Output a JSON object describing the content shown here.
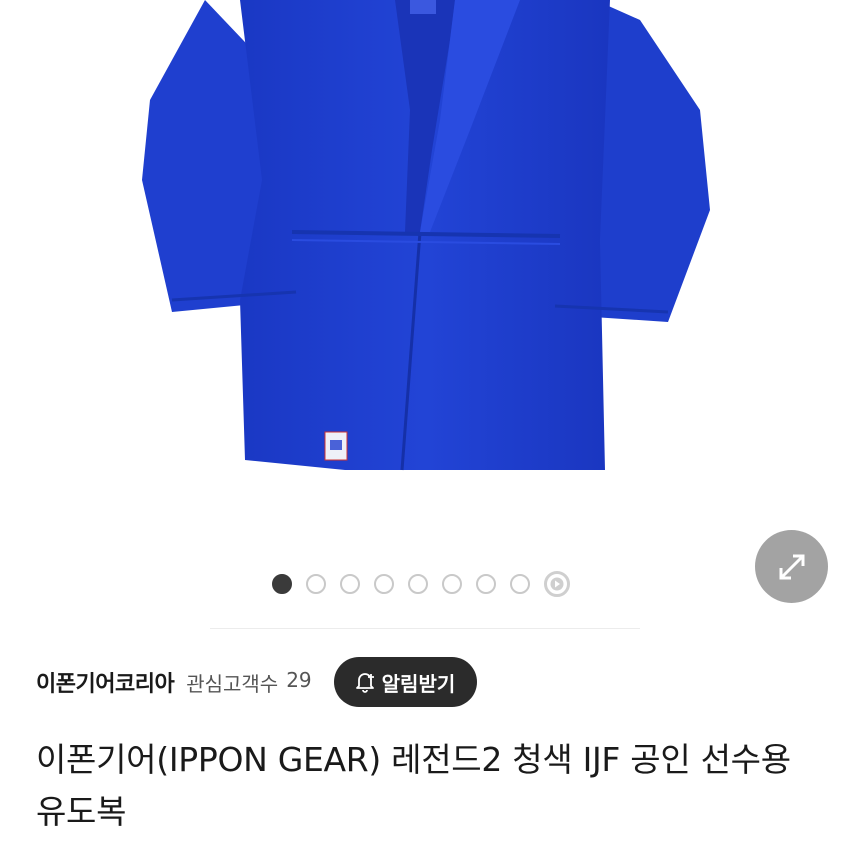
{
  "image_viewer": {
    "image_description_icon": "judo-gi-photo",
    "expand_icon": "expand-arrows-icon",
    "pager": {
      "total_dots": 8,
      "active_index": 0,
      "has_video_dot": true
    }
  },
  "seller": {
    "name": "이폰기어코리아",
    "followers_label": "관심고객수",
    "followers_count": "29",
    "notify_button_label": "알림받기"
  },
  "product": {
    "title": "이폰기어(IPPON GEAR) 레전드2 청색 IJF 공인 선수용 유도복"
  },
  "colors": {
    "gi_blue": "#1f3fcf",
    "gi_shadow": "#1530a8",
    "button_dark": "#2b2b2b",
    "expand_gray": "#a3a3a3"
  }
}
